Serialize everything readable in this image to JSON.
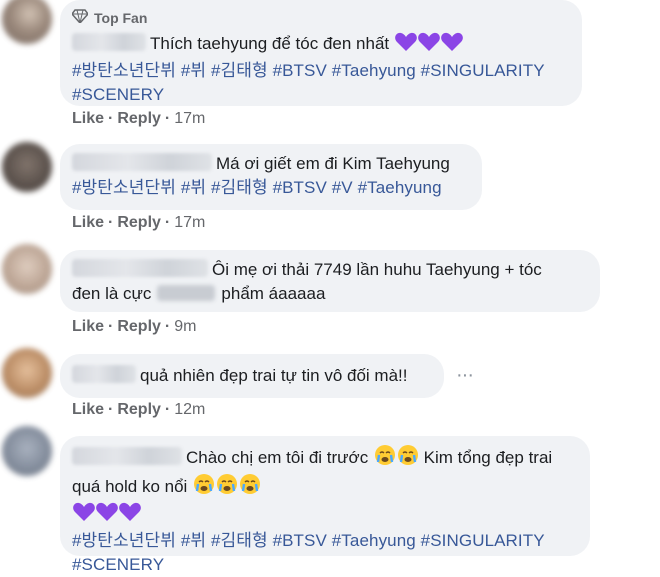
{
  "comments": [
    {
      "badge": "Top Fan",
      "text": "Thích taehyung để tóc đen nhất",
      "hashtags": [
        "#방탄소년단뷔",
        "#뷔",
        "#김태형",
        "#BTSV",
        "#Taehyung",
        "#SINGULARITY",
        "#SCENERY"
      ],
      "like": "Like",
      "reply": "Reply",
      "time": "17m"
    },
    {
      "text": "Má ơi giết em đi Kim Taehyung",
      "hashtags": [
        "#방탄소년단뷔",
        "#뷔",
        "#김태형",
        "#BTSV",
        "#V",
        "#Taehyung"
      ],
      "like": "Like",
      "reply": "Reply",
      "time": "17m"
    },
    {
      "text_line1": "Ôi mẹ ơi thải 7749 lần huhu Taehyung + tóc",
      "text_line2a": "đen là cực",
      "text_line2b": "phẩm áaaaaa",
      "like": "Like",
      "reply": "Reply",
      "time": "9m"
    },
    {
      "text": "quả nhiên đẹp trai tự tin vô đối mà!!",
      "like": "Like",
      "reply": "Reply",
      "time": "12m"
    },
    {
      "text_line1": "Chào chị em tôi đi trước",
      "text_line1b": "Kim tổng đẹp trai",
      "text_line2": "quá hold ko nổi",
      "hashtags": [
        "#방탄소년단뷔",
        "#뷔",
        "#김태형",
        "#BTSV",
        "#Taehyung",
        "#SINGULARITY"
      ],
      "hashtag_cut": "#SCENERY"
    }
  ],
  "separator": "·",
  "colors": {
    "bubble": "#f0f2f5",
    "link": "#385898",
    "meta": "#65676b",
    "heart": "#8b45e6"
  },
  "icons": [
    "diamond-icon",
    "purple-heart-icon",
    "crying-face-icon",
    "more-options-icon"
  ]
}
